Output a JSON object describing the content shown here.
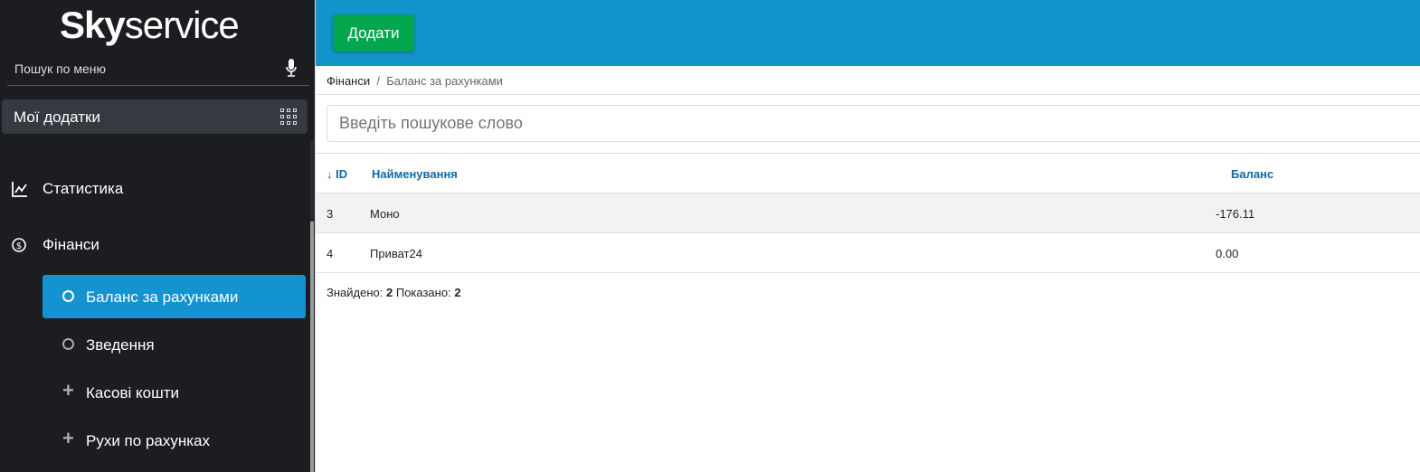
{
  "sidebar": {
    "logo_bold": "Sky",
    "logo_light": "service",
    "search_label": "Пошук по меню",
    "apps_label": "Мої додатки",
    "items": [
      {
        "label": "Статистика",
        "icon": "chart-line-icon"
      },
      {
        "label": "Фінанси",
        "icon": "dollar-circle-icon"
      }
    ],
    "subitems": [
      {
        "label": "Баланс за рахунками",
        "icon": "circle-icon",
        "active": true
      },
      {
        "label": "Зведення",
        "icon": "circle-icon"
      },
      {
        "label": "Касові кошти",
        "icon": "plus-icon"
      },
      {
        "label": "Рухи по рахунках",
        "icon": "plus-icon"
      }
    ]
  },
  "toolbar": {
    "add_label": "Додати"
  },
  "breadcrumb": {
    "parent": "Фінанси",
    "sep": "/",
    "current": "Баланс за рахунками"
  },
  "search": {
    "placeholder": "Введіть пошукове слово",
    "value": ""
  },
  "table": {
    "headers": {
      "id": "↓ ID",
      "name": "Найменування",
      "balance": "Баланс"
    },
    "rows": [
      {
        "id": "3",
        "name": "Моно",
        "balance": "-176.11"
      },
      {
        "id": "4",
        "name": "Приват24",
        "balance": "0.00"
      }
    ]
  },
  "footer": {
    "found_label": "Знайдено:",
    "found": "2",
    "shown_label": "Показано:",
    "shown": "2"
  },
  "colors": {
    "accent": "#1393cc",
    "add": "#03a64d",
    "sidebar": "#1c1d21"
  }
}
